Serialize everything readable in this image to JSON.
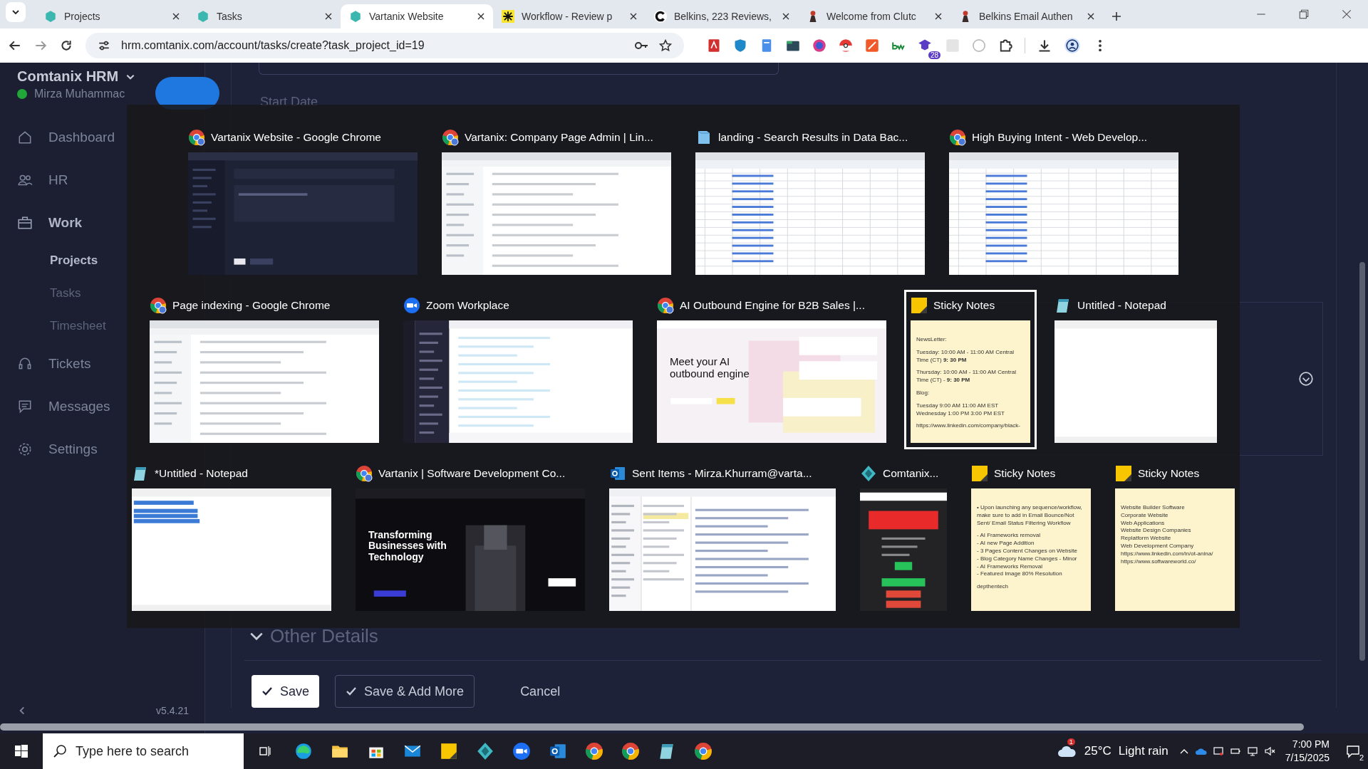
{
  "browser": {
    "tabs": [
      {
        "title": "Projects",
        "kind": "hex",
        "selected": false
      },
      {
        "title": "Tasks",
        "kind": "hex",
        "selected": false
      },
      {
        "title": "Vartanix Website",
        "kind": "hex",
        "selected": true
      },
      {
        "title": "Workflow - Review p",
        "kind": "burst",
        "selected": false
      },
      {
        "title": "Belkins, 223 Reviews,",
        "kind": "c-logo",
        "selected": false
      },
      {
        "title": "Welcome from Clutc",
        "kind": "drop",
        "selected": false
      },
      {
        "title": "Belkins Email Authen",
        "kind": "drop",
        "selected": false
      }
    ],
    "url": "hrm.comtanix.com/account/tasks/create?task_project_id=19",
    "extension_badge": "28"
  },
  "sidebar": {
    "title": "Comtanix HRM",
    "user": "Mirza Muhammac",
    "user_online": true,
    "items": [
      {
        "label": "Dashboard",
        "selected": false
      },
      {
        "label": "HR",
        "selected": false
      },
      {
        "label": "Work",
        "selected": false,
        "children": [
          {
            "label": "Projects",
            "selected": true
          },
          {
            "label": "Tasks",
            "selected": false
          },
          {
            "label": "Timesheet",
            "selected": false
          }
        ]
      },
      {
        "label": "Tickets",
        "selected": false
      },
      {
        "label": "Messages",
        "selected": false
      },
      {
        "label": "Settings",
        "selected": false
      }
    ],
    "version": "v5.4.21"
  },
  "form": {
    "start_date_label": "Start Date",
    "section": "Other Details",
    "buttons": [
      {
        "label": "Save",
        "kind": "primary"
      },
      {
        "label": "Save & Add More",
        "kind": "outline"
      },
      {
        "label": "Cancel",
        "kind": "link"
      }
    ]
  },
  "task_switcher": {
    "rows": [
      [
        {
          "title": "Vartanix Website - Google Chrome",
          "kind": "dark",
          "selected": false
        },
        {
          "title": "Vartanix: Company Page Admin | Lin...",
          "kind": "light",
          "selected": false
        },
        {
          "title": "landing - Search Results in Data Bac...",
          "kind": "sheet",
          "selected": false
        },
        {
          "title": "High Buying Intent - Web Develop...",
          "kind": "sheet",
          "selected": false
        }
      ],
      [
        {
          "title": "Page indexing - Google Chrome",
          "kind": "light",
          "selected": false
        },
        {
          "title": "Zoom Workplace",
          "kind": "zoomapp",
          "selected": false
        },
        {
          "title": "AI Outbound Engine for B2B Sales |...",
          "kind": "hero-light",
          "headline": "Meet your AI outbound engine",
          "selected": false
        },
        {
          "title": "Sticky Notes",
          "kind": "sticky",
          "selected": true,
          "note": [
            "NewsLetter:",
            "Tuesday: 10:00 AM - 11:00 AM Central Time (CT)   **9: 30 PM**",
            "Thursday: 10:00 AM - 11:00 AM Central Time (CT) - **9: 30 PM**",
            "Blog:",
            "Tuesday   9:00 AM   11:00 AM EST\nWednesday   1:00 PM   3:00 PM EST",
            "https://www.linkedin.com/company/black-"
          ]
        },
        {
          "title": "Untitled - Notepad",
          "kind": "blank",
          "selected": false
        }
      ],
      [
        {
          "title": "*Untitled - Notepad",
          "kind": "notepad",
          "selected": false
        },
        {
          "title": "Vartanix | Software Development Co...",
          "kind": "hero-dark",
          "headline": "Transforming Businesses with Technology",
          "selected": false
        },
        {
          "title": "Sent Items - Mirza.Khurram@varta...",
          "kind": "mail",
          "selected": false
        },
        {
          "title": "Comtanix...",
          "kind": "red-app",
          "selected": false
        },
        {
          "title": "Sticky Notes",
          "kind": "sticky",
          "selected": false,
          "note": [
            "• Upon launching any sequence/workflow, make sure to add in Email Bounce/Not Sent/ Email Status Filtering Workflow",
            "- AI Frameworks removal\n- AI new Page Addition\n- 3 Pages Content Changes on Website\n- Blog Category Name Changes - Minor\n- AI Frameworks Removal\n- Featured Image 80% Resolution",
            "depthentech"
          ]
        },
        {
          "title": "Sticky Notes",
          "kind": "sticky",
          "selected": false,
          "note": [
            "Website Builder Software\nCorporate Website\nWeb Applications\nWebsite Design Companies\nReplatform Website\nWeb Development Company\nhttps://www.linkedin.com/in/ot-anina/\nhttps://www.softwareworld.co/"
          ]
        }
      ]
    ]
  },
  "taskbar": {
    "search": {
      "placeholder": "Type here to search"
    },
    "apps": [
      {
        "kind": "edge"
      },
      {
        "kind": "folder"
      },
      {
        "kind": "store"
      },
      {
        "kind": "mail"
      },
      {
        "kind": "sticky"
      },
      {
        "kind": "comtanix"
      },
      {
        "kind": "zoom"
      },
      {
        "kind": "outlook"
      },
      {
        "kind": "chrome"
      },
      {
        "kind": "chrome"
      },
      {
        "kind": "notepad"
      },
      {
        "kind": "chrome"
      }
    ],
    "weather_badge": "1",
    "temperature": "25°C",
    "weather": "Light rain",
    "time": "7:00 PM",
    "date": "7/15/2025",
    "notifications": "2"
  }
}
